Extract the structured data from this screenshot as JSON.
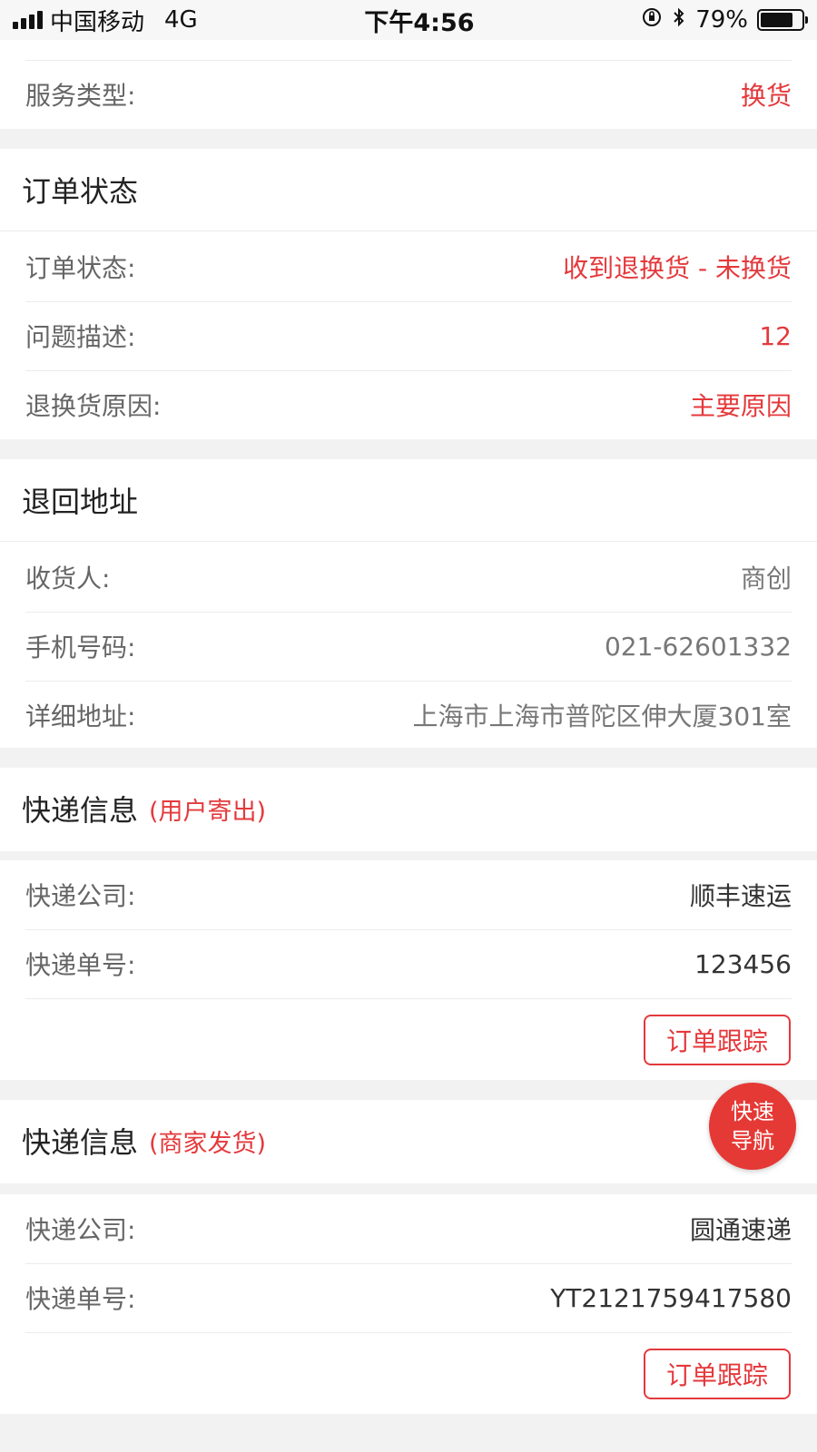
{
  "status_bar": {
    "carrier": "中国移动",
    "network": "4G",
    "time": "下午4:56",
    "battery_percent": "79%",
    "battery_level": 0.79
  },
  "service": {
    "label": "服务类型:",
    "value": "换货"
  },
  "order_status_section": {
    "title": "订单状态",
    "rows": [
      {
        "label": "订单状态:",
        "value": "收到退换货 - 未换货"
      },
      {
        "label": "问题描述:",
        "value": "12"
      },
      {
        "label": "退换货原因:",
        "value": "主要原因"
      }
    ]
  },
  "return_address_section": {
    "title": "退回地址",
    "rows": [
      {
        "label": "收货人:",
        "value": "商创"
      },
      {
        "label": "手机号码:",
        "value": "021-62601332"
      },
      {
        "label": "详细地址:",
        "value": "上海市上海市普陀区伸大厦301室"
      }
    ]
  },
  "shipping_user": {
    "title": "快递信息",
    "subtitle": "(用户寄出)",
    "rows": [
      {
        "label": "快递公司:",
        "value": "顺丰速运"
      },
      {
        "label": "快递单号:",
        "value": "123456"
      }
    ],
    "track_label": "订单跟踪"
  },
  "shipping_merchant": {
    "title": "快递信息",
    "subtitle": "(商家发货)",
    "rows": [
      {
        "label": "快递公司:",
        "value": "圆通速递"
      },
      {
        "label": "快递单号:",
        "value": "YT2121759417580"
      }
    ],
    "track_label": "订单跟踪"
  },
  "fab": {
    "line1": "快速",
    "line2": "导航"
  },
  "colors": {
    "accent": "#e4393c",
    "background": "#f2f2f2"
  }
}
